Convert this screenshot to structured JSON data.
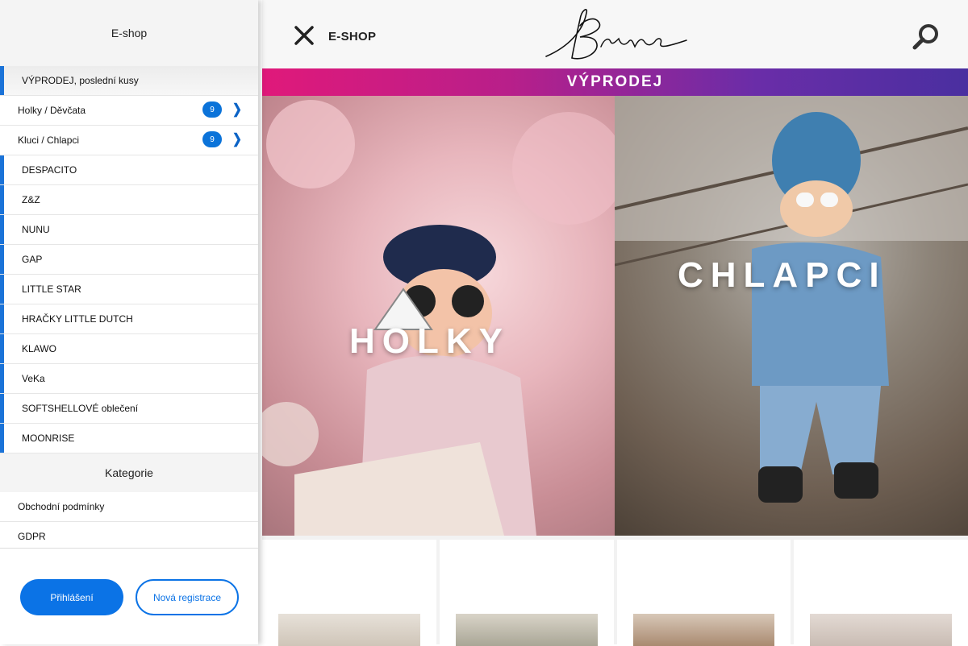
{
  "sidebar": {
    "header": "E-shop",
    "items": [
      {
        "label": "VÝPRODEJ, poslední kusy",
        "style": "accent-shaded"
      },
      {
        "label": "Holky / Děvčata",
        "badge": "9",
        "style": "plain"
      },
      {
        "label": "Kluci / Chlapci",
        "badge": "9",
        "style": "plain"
      },
      {
        "label": "DESPACITO",
        "style": "accent"
      },
      {
        "label": "Z&Z",
        "style": "accent"
      },
      {
        "label": "NUNU",
        "style": "accent"
      },
      {
        "label": "GAP",
        "style": "accent"
      },
      {
        "label": "LITTLE STAR",
        "style": "accent"
      },
      {
        "label": "HRAČKY LITTLE DUTCH",
        "style": "accent"
      },
      {
        "label": "KLAWO",
        "style": "accent"
      },
      {
        "label": "VeKa",
        "style": "accent"
      },
      {
        "label": "SOFTSHELLOVÉ oblečení",
        "style": "accent"
      },
      {
        "label": "MOONRISE",
        "style": "accent"
      }
    ],
    "section_title": "Kategorie",
    "pages": [
      {
        "label": "Obchodní podmínky"
      },
      {
        "label": "GDPR"
      }
    ],
    "login_label": "Přihlášení",
    "register_label": "Nová registrace"
  },
  "header": {
    "eshop_label": "E-SHOP",
    "close_icon": "close-icon",
    "search_icon": "search-icon",
    "logo_name": "Brave script logo"
  },
  "promo": {
    "label": "VÝPRODEJ"
  },
  "banners": {
    "girls": "HOLKY",
    "boys": "CHLAPCI"
  },
  "colors": {
    "accent": "#1b73d8",
    "button": "#0b73e6",
    "promo_start": "#e0197a",
    "promo_end": "#4a2fa0"
  }
}
